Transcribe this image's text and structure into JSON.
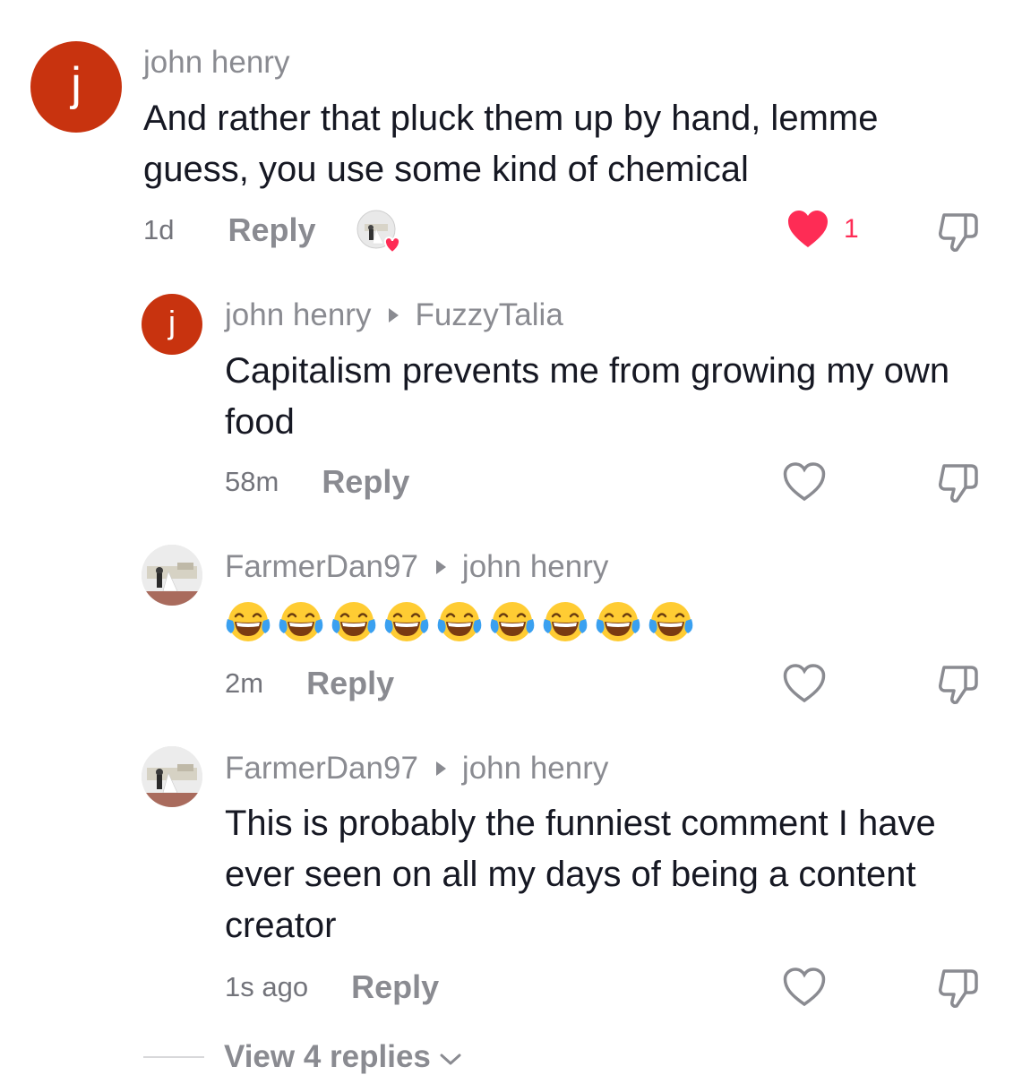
{
  "comments": [
    {
      "avatar_letter": "j",
      "author": "john henry",
      "text": "And rather that pluck them up by hand, lemme guess, you use some kind of chemical",
      "time": "1d",
      "reply_label": "Reply",
      "like_count": "1",
      "liked": true
    },
    {
      "avatar_letter": "j",
      "author": "john henry",
      "reply_to": "FuzzyTalia",
      "text": "Capitalism prevents me from growing my own food",
      "time": "58m",
      "reply_label": "Reply",
      "liked": false
    },
    {
      "author": "FarmerDan97",
      "reply_to": "john henry",
      "emoji_count": 9,
      "time": "2m",
      "reply_label": "Reply",
      "liked": false
    },
    {
      "author": "FarmerDan97",
      "reply_to": "john henry",
      "text": "This is probably the funniest comment I have ever seen on all my days of being a content creator",
      "time": "1s ago",
      "reply_label": "Reply",
      "liked": false
    }
  ],
  "view_replies": {
    "label": "View 4 replies"
  },
  "colors": {
    "like_red": "#fe2c55",
    "avatar_orange": "#c8330f",
    "muted_gray": "#8a8b91"
  },
  "icons": {
    "like": "heart-icon",
    "dislike": "thumbs-down-icon",
    "expand": "chevron-down-icon",
    "emoji": "tears-of-joy-emoji"
  }
}
